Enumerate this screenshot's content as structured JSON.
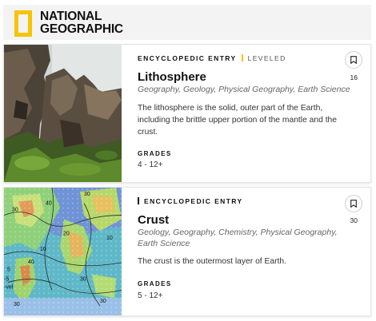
{
  "logo": {
    "line1": "NATIONAL",
    "line2": "GEOGRAPHIC"
  },
  "cards": [
    {
      "kicker": "ENCYCLOPEDIC ENTRY",
      "level": "LEVELED",
      "title": "Lithosphere",
      "subjects": "Geography, Geology, Physical Geography, Earth Science",
      "description": "The lithosphere is the solid, outer part of the Earth, including the brittle upper portion of the mantle and the crust.",
      "grades_label": "GRADES",
      "grades": "4 - 12+",
      "bookmark_count": "16",
      "bookmark_icon": "bookmark-icon"
    },
    {
      "kicker": "ENCYCLOPEDIC ENTRY",
      "title": "Crust",
      "subjects": "Geology, Geography, Chemistry, Physical Geography, Earth Science",
      "description": "The crust is the outermost layer of Earth.",
      "grades_label": "GRADES",
      "grades": "5 - 12+",
      "bookmark_count": "30",
      "bookmark_icon": "bookmark-icon",
      "map_labels": [
        "30",
        "40",
        "30",
        "10",
        "20",
        "10",
        "40",
        "30",
        "5",
        "30",
        "-5",
        "-vel",
        "30"
      ]
    }
  ],
  "colors": {
    "accent": "#f6c400"
  }
}
